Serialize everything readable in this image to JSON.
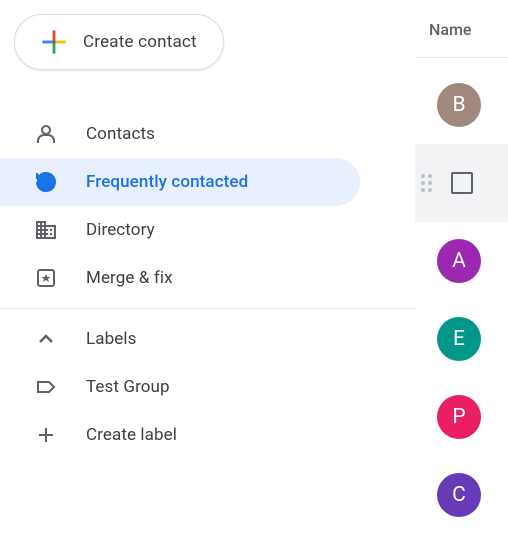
{
  "create_button": {
    "label": "Create contact"
  },
  "nav": {
    "contacts": "Contacts",
    "frequently_contacted": "Frequently contacted",
    "directory": "Directory",
    "merge_fix": "Merge & fix",
    "labels": "Labels",
    "test_group": "Test Group",
    "create_label": "Create label"
  },
  "main": {
    "column_header": "Name"
  },
  "contacts": [
    {
      "initial": "B",
      "color": "#a1887f",
      "hovered": false
    },
    {
      "initial": "",
      "color": "",
      "hovered": true
    },
    {
      "initial": "A",
      "color": "#9c27b0",
      "hovered": false
    },
    {
      "initial": "E",
      "color": "#009688",
      "hovered": false
    },
    {
      "initial": "P",
      "color": "#e91e63",
      "hovered": false
    },
    {
      "initial": "C",
      "color": "#673ab7",
      "hovered": false
    }
  ]
}
